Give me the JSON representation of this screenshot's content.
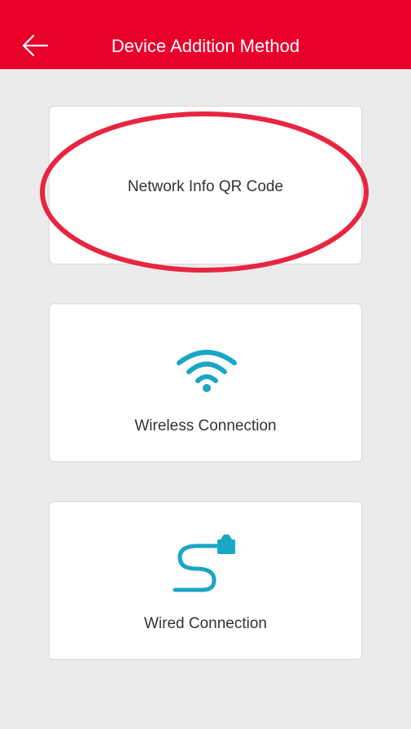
{
  "header": {
    "title": "Device Addition Method",
    "back_icon": "arrow-left-icon",
    "background_color": "#e8002b"
  },
  "methods": [
    {
      "label": "Network Info QR Code",
      "icon": ""
    },
    {
      "label": "Wireless Connection",
      "icon": "wifi-icon"
    },
    {
      "label": "Wired Connection",
      "icon": "ethernet-cable-icon"
    }
  ],
  "accent_color": "#1aa6c4",
  "annotation_color": "#e8253f"
}
